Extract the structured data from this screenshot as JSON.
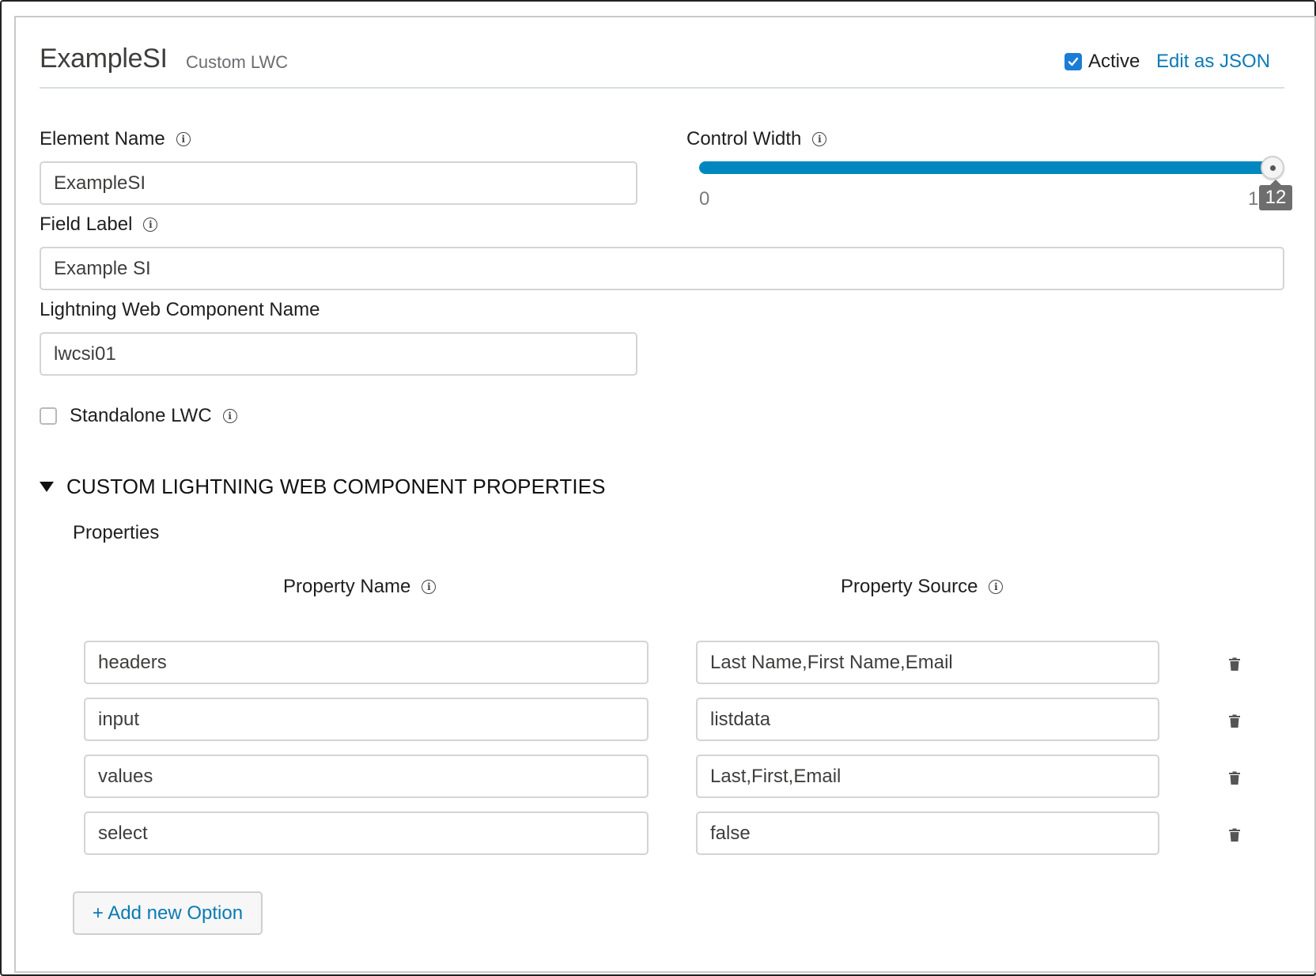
{
  "header": {
    "title": "ExampleSI",
    "subtitle": "Custom LWC",
    "active_label": "Active",
    "active_checked": true,
    "edit_json_label": "Edit as JSON"
  },
  "element_name": {
    "label": "Element Name",
    "value": "ExampleSI"
  },
  "control_width": {
    "label": "Control Width",
    "value": 12,
    "min": 0,
    "max": 12,
    "min_label": "0",
    "max_label": "1",
    "tooltip": "12"
  },
  "field_label": {
    "label": "Field Label",
    "value": "Example SI"
  },
  "lwc_name": {
    "label": "Lightning Web Component Name",
    "value": "lwcsi01"
  },
  "standalone": {
    "label": "Standalone LWC",
    "checked": false
  },
  "custom_section": {
    "title": "CUSTOM LIGHTNING WEB COMPONENT PROPERTIES",
    "properties_label": "Properties",
    "col_name": "Property Name",
    "col_source": "Property Source",
    "rows": [
      {
        "name": "headers",
        "source": "Last Name,First Name,Email"
      },
      {
        "name": "input",
        "source": "listdata"
      },
      {
        "name": "values",
        "source": "Last,First,Email"
      },
      {
        "name": "select",
        "source": "false"
      }
    ],
    "add_button_label": "+ Add new Option"
  },
  "colors": {
    "accent": "#0087c0",
    "link": "#0b7bb5",
    "checkbox": "#1b7cd6"
  }
}
